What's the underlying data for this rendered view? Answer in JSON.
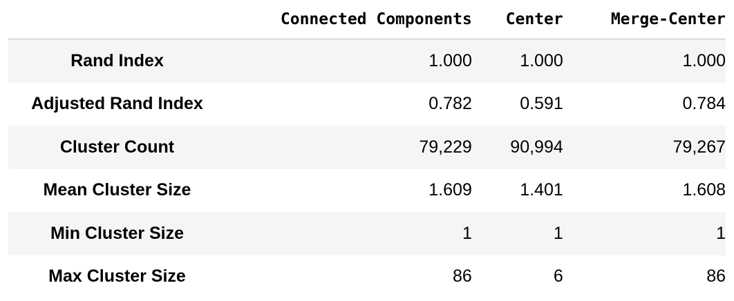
{
  "table": {
    "columns": [
      "Connected Components",
      "Center",
      "Merge-Center"
    ],
    "rows": [
      {
        "label": "Rand Index",
        "values": [
          "1.000",
          "1.000",
          "1.000"
        ]
      },
      {
        "label": "Adjusted Rand Index",
        "values": [
          "0.782",
          "0.591",
          "0.784"
        ]
      },
      {
        "label": "Cluster Count",
        "values": [
          "79,229",
          "90,994",
          "79,267"
        ]
      },
      {
        "label": "Mean Cluster Size",
        "values": [
          "1.609",
          "1.401",
          "1.608"
        ]
      },
      {
        "label": "Min Cluster Size",
        "values": [
          "1",
          "1",
          "1"
        ]
      },
      {
        "label": "Max Cluster Size",
        "values": [
          "86",
          "6",
          "86"
        ]
      }
    ]
  }
}
